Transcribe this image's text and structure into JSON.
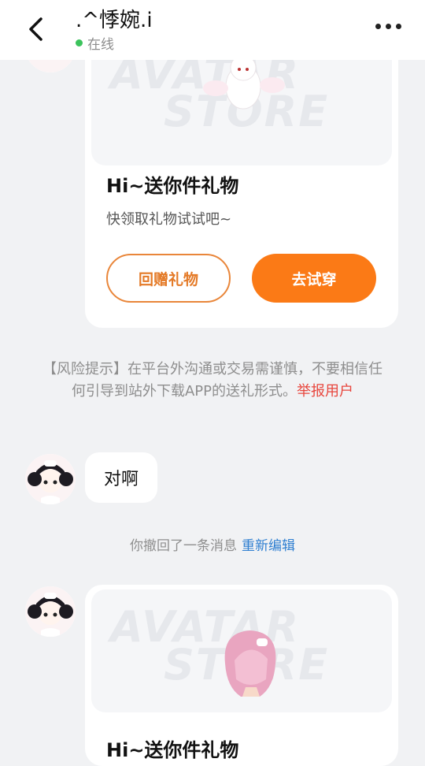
{
  "header": {
    "title": ".^悸婉.i",
    "status": "在线",
    "status_color": "#3cc35c"
  },
  "gift_card_1": {
    "preview_watermark": [
      "AVATAR",
      "STORE"
    ],
    "title": "Hi~送你件礼物",
    "subtitle": "快领取礼物试试吧~",
    "gift_button": "回赠礼物",
    "try_button": "去试穿"
  },
  "risk_notice": {
    "text": "【风险提示】在平台外沟通或交易需谨慎，不要相信任何引导到站外下载APP的送礼形式。",
    "report_link": "举报用户"
  },
  "message": {
    "text": "对啊"
  },
  "recall_notice": {
    "text": "你撤回了一条消息",
    "reedit": "重新编辑"
  },
  "gift_card_2": {
    "preview_watermark": [
      "AVATAR",
      "STORE"
    ],
    "title": "Hi~送你件礼物"
  },
  "colors": {
    "accent": "#fb7a16",
    "link_red": "#e8453c",
    "link_blue": "#2f7fd1"
  }
}
